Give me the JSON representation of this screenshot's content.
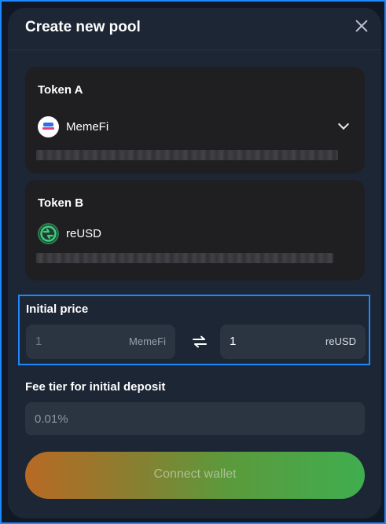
{
  "dialog": {
    "title": "Create new pool"
  },
  "token_a": {
    "label": "Token A",
    "name": "MemeFi",
    "logo_icon": "memefi-logo-icon"
  },
  "token_b": {
    "label": "Token B",
    "name": "reUSD",
    "logo_icon": "reusd-logo-icon"
  },
  "initial_price": {
    "label": "Initial price",
    "left_value": "1",
    "left_unit": "MemeFi",
    "right_value": "1",
    "right_unit": "reUSD",
    "swap_icon": "swap-arrows-icon"
  },
  "fee_tier": {
    "label": "Fee tier for initial deposit",
    "value": "0.01%"
  },
  "actions": {
    "connect_label": "Connect wallet"
  },
  "colors": {
    "accent_border": "#1e88ff",
    "modal_bg": "#1c2634",
    "card_bg": "#1f1f22",
    "input_bg": "#2b3441",
    "button_gradient_start": "#b86a24",
    "button_gradient_end": "#3fae4f"
  }
}
